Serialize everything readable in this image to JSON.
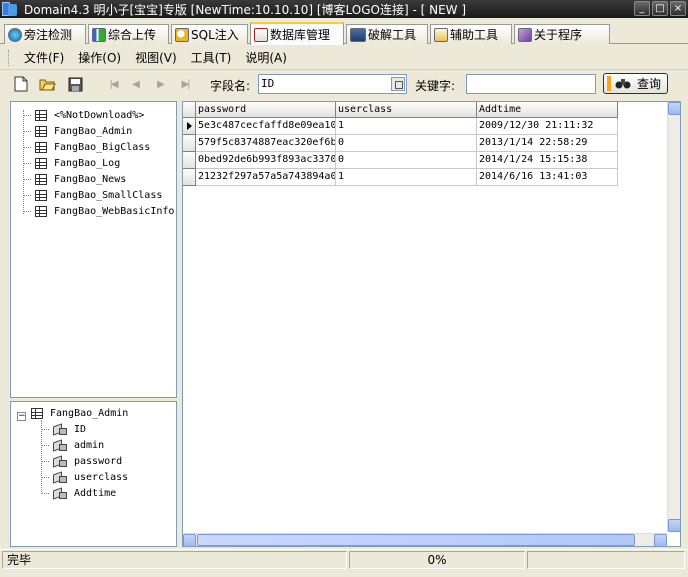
{
  "window": {
    "title": "Domain4.3 明小子[宝宝]专版 [NewTime:10.10.10] [博客LOGO连接]  - [ NEW ]",
    "buttons": [
      "_",
      "□",
      "×"
    ]
  },
  "tabs": [
    {
      "label": "旁注检测",
      "icon": "globe-icon",
      "active": false
    },
    {
      "label": "综合上传",
      "icon": "chart-icon",
      "active": false
    },
    {
      "label": "SQL注入",
      "icon": "magnifier-icon",
      "active": false
    },
    {
      "label": "数据库管理",
      "icon": "database-icon",
      "active": true
    },
    {
      "label": "破解工具",
      "icon": "toolbox-icon",
      "active": false
    },
    {
      "label": "辅助工具",
      "icon": "document-icon",
      "active": false
    },
    {
      "label": "关于程序",
      "icon": "info-icon",
      "active": false
    }
  ],
  "menu": [
    "文件(F)",
    "操作(O)",
    "视图(V)",
    "工具(T)",
    "说明(A)"
  ],
  "toolbar": {
    "field_label": "字段名:",
    "field_value": "ID",
    "keyword_label": "关键字:",
    "keyword_value": "",
    "query_label": "查询"
  },
  "tables": [
    "<%NotDownload%>",
    "FangBao_Admin",
    "FangBao_BigClass",
    "FangBao_Log",
    "FangBao_News",
    "FangBao_SmallClass",
    "FangBao_WebBasicInfo"
  ],
  "fields_tree": {
    "table": "FangBao_Admin",
    "fields": [
      "ID",
      "admin",
      "password",
      "userclass",
      "Addtime"
    ]
  },
  "grid": {
    "columns": [
      "password",
      "userclass",
      "Addtime"
    ],
    "rows": [
      [
        "5e3c487cecfaffd8e09ea10",
        "1",
        "2009/12/30 21:11:32"
      ],
      [
        "579f5c8374887eac320ef6b",
        "0",
        "2013/1/14 22:58:29"
      ],
      [
        "0bed92de6b993f893ac3370",
        "0",
        "2014/1/24 15:15:38"
      ],
      [
        "21232f297a57a5a743894a0",
        "1",
        "2014/6/16 13:41:03"
      ]
    ]
  },
  "status": {
    "left": "完毕",
    "progress": "0%"
  },
  "colors": {
    "accent": "#ffc83c",
    "scrollbar": "#9fb8f0",
    "titlebar": "#1a1a1a"
  }
}
